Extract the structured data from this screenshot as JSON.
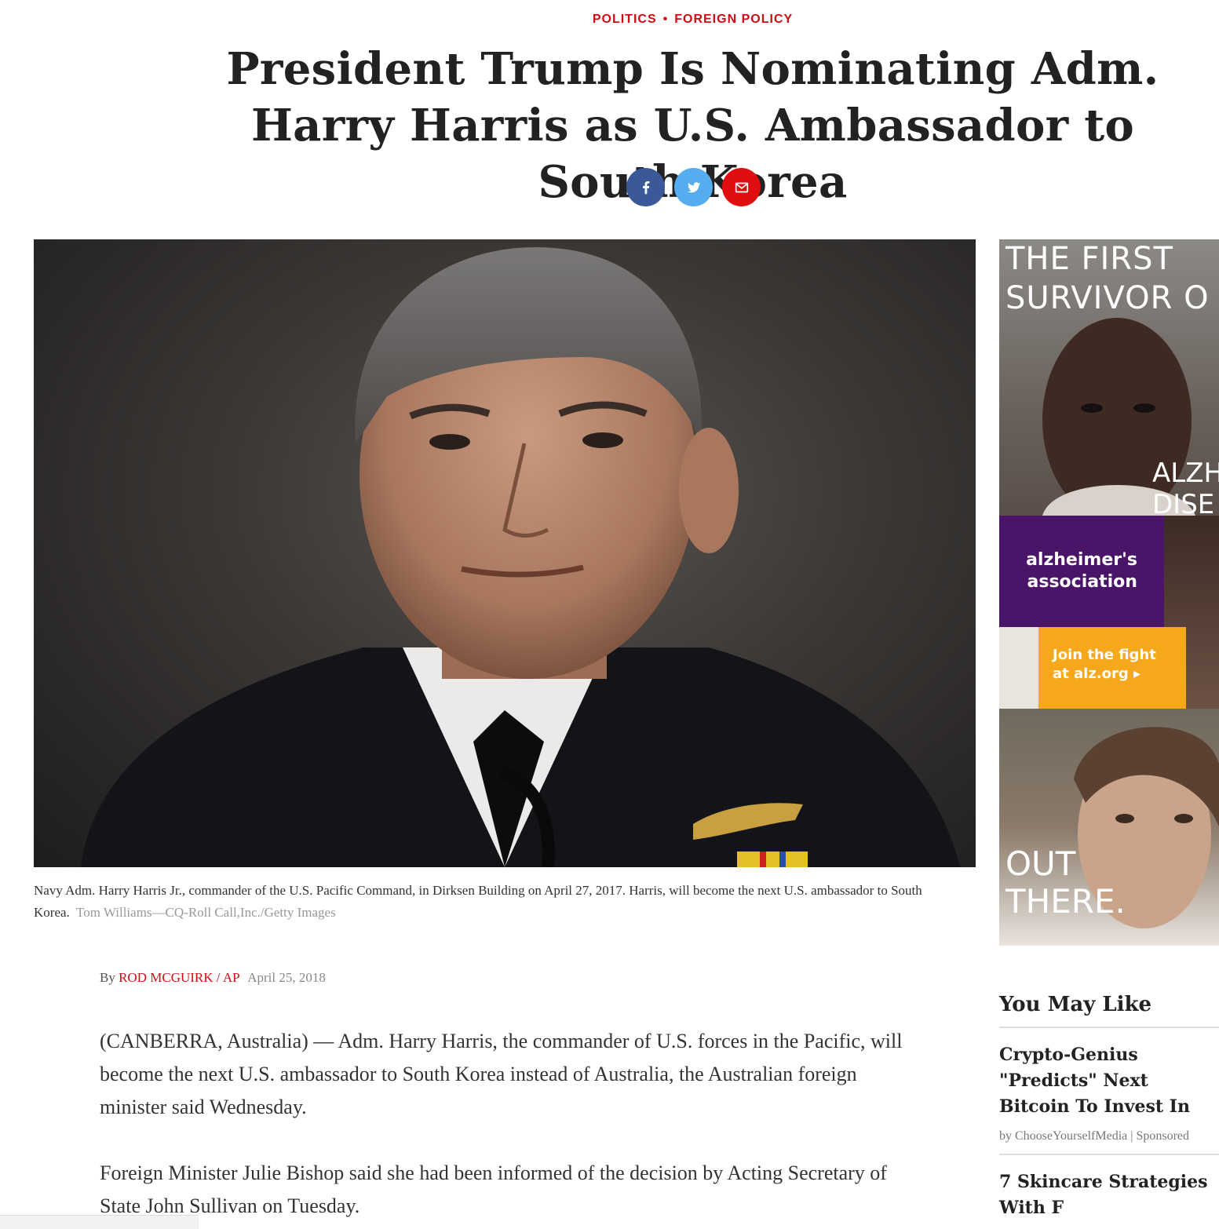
{
  "categories": {
    "primary": "POLITICS",
    "separator": "•",
    "secondary": "FOREIGN POLICY"
  },
  "headline": "President Trump Is Nominating Adm. Harry Harris as U.S. Ambassador to South Korea",
  "share": {
    "facebook_icon": "facebook-icon",
    "twitter_icon": "twitter-icon",
    "email_icon": "mail-icon",
    "colors": {
      "facebook": "#3b5998",
      "twitter": "#55acee",
      "email": "#e10e10"
    }
  },
  "hero": {
    "caption": "Navy Adm. Harry Harris Jr., commander of the U.S. Pacific Command, in Dirksen Building on April 27, 2017. Harris, will become the next U.S. ambassador to South Korea.",
    "credit": "Tom Williams—CQ-Roll Call,Inc./Getty Images"
  },
  "byline": {
    "prefix": "By",
    "author": "Rod McGuirk",
    "separator": "/",
    "agency": "AP",
    "date": "April 25, 2018"
  },
  "article": {
    "paragraphs": [
      "(CANBERRA, Australia) — Adm. Harry Harris, the commander of U.S. forces in the Pacific, will become the next U.S. ambassador to South Korea instead of Australia, the Australian foreign minister said Wednesday.",
      "Foreign Minister Julie Bishop said she had been informed of the decision by Acting Secretary of State John Sullivan on Tuesday."
    ]
  },
  "ad": {
    "headline_line1": "THE FIRST",
    "headline_line2": "SURVIVOR O",
    "side_line1": "ALZH",
    "side_line2": "DISE",
    "brand_line1": "alzheimer's",
    "brand_line2": "association",
    "cta_line1": "Join the fight",
    "cta_line2": "at alz.org ▸",
    "bottom_line1": "OUT",
    "bottom_line2": "THERE.",
    "colors": {
      "purple": "#4a1469",
      "orange": "#f5a81c"
    }
  },
  "you_may_like": {
    "heading": "You May Like",
    "items": [
      {
        "title": "Crypto-Genius \"Predicts\" Next Bitcoin To Invest In",
        "source": "by ChooseYourselfMedia | Sponsored"
      },
      {
        "title": "7 Skincare Strategies With F",
        "source": ""
      }
    ]
  },
  "accent_color": "#d20a11"
}
